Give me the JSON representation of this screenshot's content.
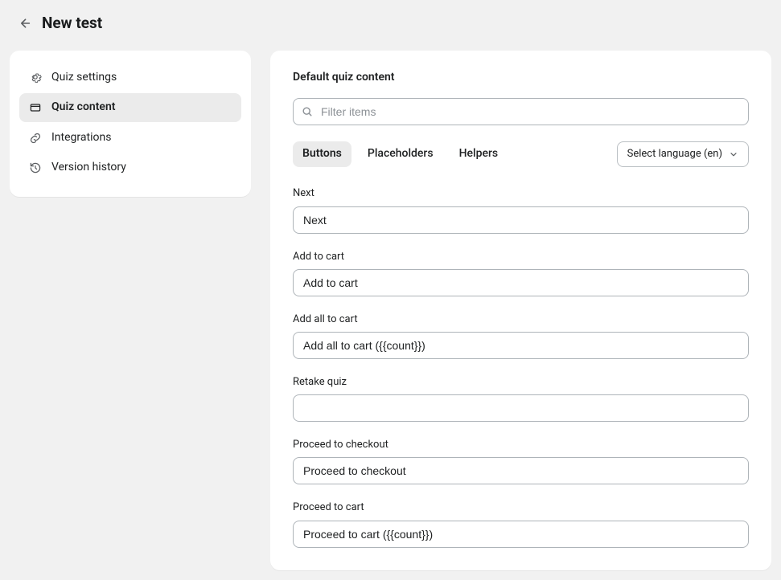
{
  "header": {
    "title": "New test"
  },
  "sidebar": {
    "items": [
      {
        "label": "Quiz settings",
        "icon": "gear-icon",
        "active": false
      },
      {
        "label": "Quiz content",
        "icon": "panel-icon",
        "active": true
      },
      {
        "label": "Integrations",
        "icon": "link-icon",
        "active": false
      },
      {
        "label": "Version history",
        "icon": "history-icon",
        "active": false
      }
    ]
  },
  "main": {
    "section_title": "Default quiz content",
    "filter_placeholder": "Filter items",
    "tabs": [
      {
        "label": "Buttons",
        "active": true
      },
      {
        "label": "Placeholders",
        "active": false
      },
      {
        "label": "Helpers",
        "active": false
      }
    ],
    "language_selector_label": "Select language (en)",
    "fields": [
      {
        "label": "Next",
        "value": "Next"
      },
      {
        "label": "Add to cart",
        "value": "Add to cart"
      },
      {
        "label": "Add all to cart",
        "value": "Add all to cart ({{count}})"
      },
      {
        "label": "Retake quiz",
        "value": ""
      },
      {
        "label": "Proceed to checkout",
        "value": "Proceed to checkout"
      },
      {
        "label": "Proceed to cart",
        "value": "Proceed to cart ({{count}})"
      }
    ]
  }
}
